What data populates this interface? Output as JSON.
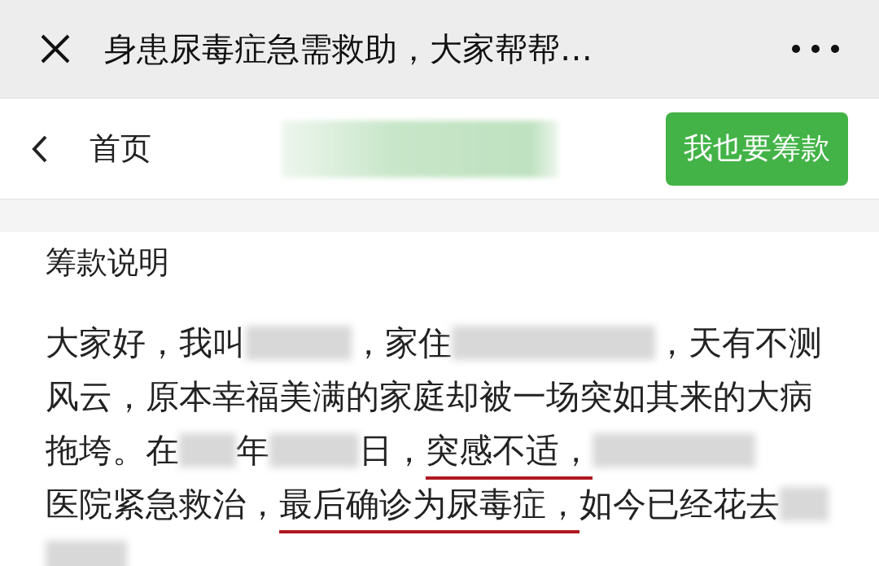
{
  "window": {
    "title": "身患尿毒症急需救助，大家帮帮…"
  },
  "nav": {
    "back_label": "首页",
    "action_button": "我也要筹款"
  },
  "section": {
    "title": "筹款说明",
    "lines": [
      [
        {
          "kind": "text",
          "text": "大家好，我叫",
          "underlined": false
        },
        {
          "kind": "blur"
        },
        {
          "kind": "text",
          "text": "，家住",
          "underlined": false
        },
        {
          "kind": "blur"
        },
        {
          "kind": "text",
          "text": "，天有不测",
          "underlined": false
        }
      ],
      [
        {
          "kind": "text",
          "text": "风云，原本幸福美满的家庭却被一场突如其来的大病",
          "underlined": false
        }
      ],
      [
        {
          "kind": "text",
          "text": "拖垮。在",
          "underlined": false
        },
        {
          "kind": "blur"
        },
        {
          "kind": "text",
          "text": "年",
          "underlined": false
        },
        {
          "kind": "blur"
        },
        {
          "kind": "text",
          "text": "日，",
          "underlined": false
        },
        {
          "kind": "text",
          "text": "突感不适，",
          "underlined": true
        },
        {
          "kind": "blur"
        }
      ],
      [
        {
          "kind": "text",
          "text": "医院紧急救治，",
          "underlined": false
        },
        {
          "kind": "text",
          "text": "最后确诊为尿毒症，",
          "underlined": true
        },
        {
          "kind": "text",
          "text": "如今已经花去",
          "underlined": false
        },
        {
          "kind": "blur"
        }
      ],
      [
        {
          "kind": "blur"
        }
      ]
    ]
  }
}
